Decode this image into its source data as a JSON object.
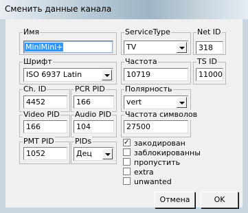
{
  "window": {
    "title": "Сменить данные канала"
  },
  "fields": {
    "name": {
      "label": "Имя",
      "value": "MiniMini+"
    },
    "service_type": {
      "label": "ServiceType",
      "value": "TV"
    },
    "net_id": {
      "label": "Net ID",
      "value": "318"
    },
    "font": {
      "label": "Шрифт",
      "value": "ISO 6937 Latin"
    },
    "frequency": {
      "label": "Частота",
      "value": "10719"
    },
    "ts_id": {
      "label": "TS ID",
      "value": "11000"
    },
    "ch_id": {
      "label": "Ch. ID",
      "value": "4452"
    },
    "pcr_pid": {
      "label": "PCR PID",
      "value": "166"
    },
    "polarity": {
      "label": "Полярность",
      "value": "vert"
    },
    "video_pid": {
      "label": "Video PID",
      "value": "166"
    },
    "audio_pid": {
      "label": "Audio PID",
      "value": "104"
    },
    "symbol_rate": {
      "label": "Частота символов",
      "value": "27500"
    },
    "pmt_pid": {
      "label": "PMT PID",
      "value": "1052"
    },
    "pids": {
      "label": "PIDs",
      "value": "Дец"
    }
  },
  "checkboxes": [
    {
      "label": "закодирован",
      "checked": true
    },
    {
      "label": "заблокированны",
      "checked": false
    },
    {
      "label": "пропустить",
      "checked": false
    },
    {
      "label": "extra",
      "checked": false
    },
    {
      "label": "unwanted",
      "checked": false
    }
  ],
  "buttons": {
    "cancel": "Отмена",
    "ok": "OK"
  }
}
